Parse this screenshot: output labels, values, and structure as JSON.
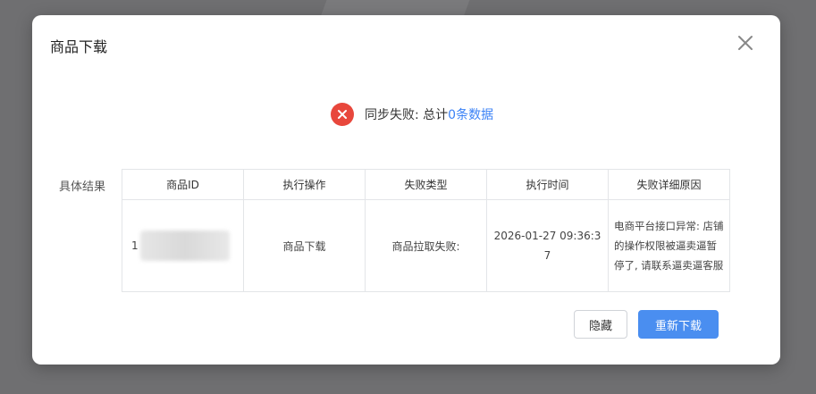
{
  "dialog": {
    "title": "商品下载",
    "status_prefix": "同步失败: 总计",
    "status_count": "0条数据",
    "result_label": "具体结果",
    "table": {
      "headers": [
        "商品ID",
        "执行操作",
        "失败类型",
        "执行时间",
        "失败详细原因"
      ],
      "rows": [
        {
          "id_prefix": "1",
          "operation": "商品下载",
          "fail_type": "商品拉取失败:",
          "time": "2026-01-27 09:36:37",
          "reason": "电商平台接口异常: 店铺的操作权限被逼卖逼暂停了, 请联系逼卖逼客服"
        }
      ]
    },
    "buttons": {
      "hide": "隐藏",
      "retry": "重新下载"
    }
  },
  "colors": {
    "error": "#e8473c",
    "link": "#3b82f6",
    "primary": "#4a8ef0"
  },
  "icons": {
    "close": "close-icon",
    "status": "error-circle-icon"
  }
}
